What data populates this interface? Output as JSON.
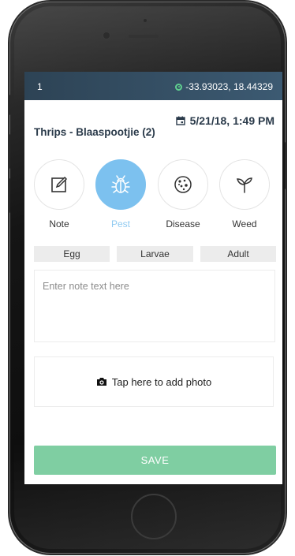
{
  "status_bar": {
    "record_number": "1",
    "coordinates": "-33.93023, 18.44329",
    "location_icon": "location-pin-icon"
  },
  "observation": {
    "title": "Thrips - Blaaspootjie (2)",
    "datetime": "5/21/18, 1:49 PM",
    "calendar_icon": "calendar-icon"
  },
  "categories": [
    {
      "label": "Note",
      "icon": "edit-icon",
      "selected": false
    },
    {
      "label": "Pest",
      "icon": "bug-icon",
      "selected": true
    },
    {
      "label": "Disease",
      "icon": "spores-icon",
      "selected": false
    },
    {
      "label": "Weed",
      "icon": "sprout-icon",
      "selected": false
    }
  ],
  "life_stages": [
    "Egg",
    "Larvae",
    "Adult"
  ],
  "note": {
    "placeholder": "Enter note text here"
  },
  "photo": {
    "label": "Tap here to add photo",
    "icon": "camera-icon"
  },
  "actions": {
    "save_label": "SAVE"
  },
  "colors": {
    "header": "#34495e",
    "accent_blue": "#7cc1ef",
    "save_green": "#7fcea2",
    "gps_green": "#5fd08f"
  }
}
